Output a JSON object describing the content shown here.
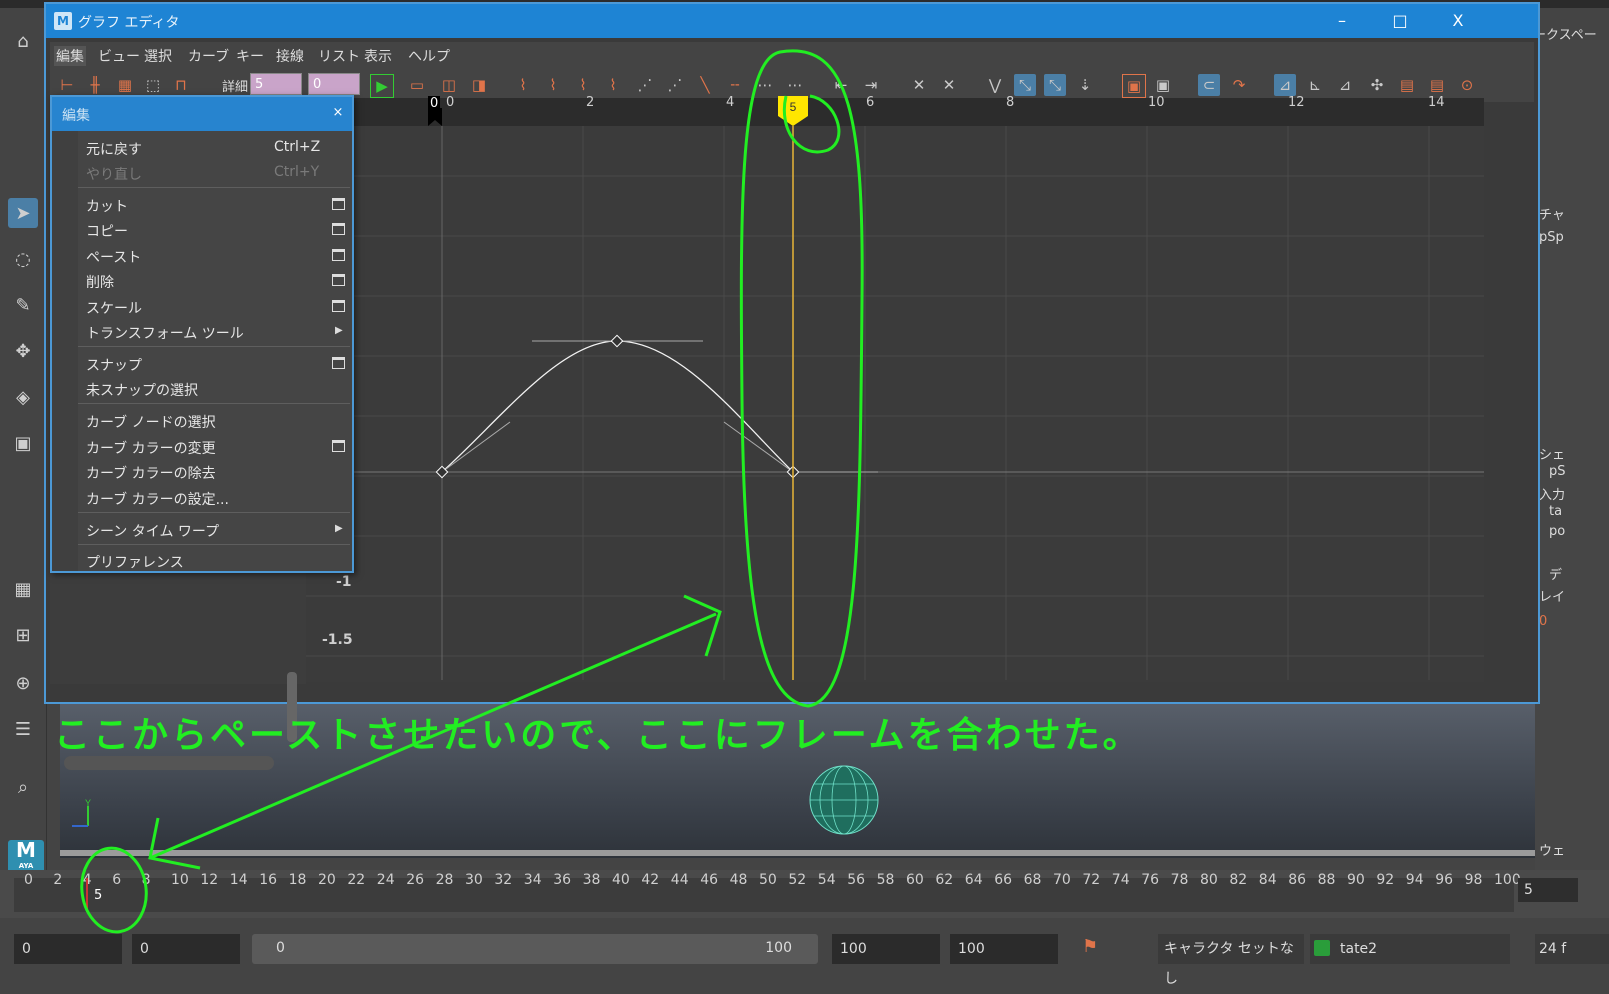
{
  "window": {
    "title": "グラフ エディタ",
    "icon": "M",
    "minimize": "–",
    "maximize": "□",
    "close": "X"
  },
  "workspace_label": "ワークスペース",
  "menubar": [
    "編集",
    "ビュー",
    "選択",
    "カーブ",
    "キー",
    "接線",
    "リスト",
    "表示",
    "ヘルプ"
  ],
  "toolbar": {
    "detail_label": "詳細",
    "detail_value": "5",
    "detail_value2": "0"
  },
  "ruler": {
    "ticks": [
      "0",
      "2",
      "4",
      "6",
      "8",
      "10",
      "12",
      "14"
    ],
    "start_marker": "0",
    "current_frame_marker": "5"
  },
  "yaxis": [
    "-1",
    "-1.5"
  ],
  "curve": {
    "color": "#ffffff",
    "keys": [
      {
        "frame": 0,
        "value": 0
      },
      {
        "frame": 2.5,
        "value": 1
      },
      {
        "frame": 5,
        "value": 0
      }
    ]
  },
  "edit_menu": {
    "title": "編集",
    "close": "×",
    "items": [
      {
        "label": "元に戻す",
        "shortcut": "Ctrl+Z",
        "disabled": false
      },
      {
        "label": "やり直し",
        "shortcut": "Ctrl+Y",
        "disabled": true
      },
      {
        "label": "カット"
      },
      {
        "label": "コピー"
      },
      {
        "label": "ペースト"
      },
      {
        "label": "削除"
      },
      {
        "label": "スケール"
      },
      {
        "label": "トランスフォーム ツール"
      },
      {
        "label": "スナップ"
      },
      {
        "label": "未スナップの選択"
      },
      {
        "label": "カーブ ノードの選択"
      },
      {
        "label": "カーブ カラーの変更"
      },
      {
        "label": "カーブ カラーの除去"
      },
      {
        "label": "カーブ カラーの設定..."
      },
      {
        "label": "シーン タイム ワープ"
      },
      {
        "label": "プリファレンス"
      }
    ]
  },
  "annotation": {
    "text": "ここからペーストさせたいので、ここにフレームを合わせた。",
    "color": "#22ee22"
  },
  "right_panel": {
    "labels": [
      "チャ",
      "pSp",
      "シェ",
      "pS",
      "入力",
      "ta",
      "po",
      "デ",
      "レイ",
      "0",
      "ウェ"
    ]
  },
  "timeline": {
    "ticks": [
      "0",
      "2",
      "4",
      "6",
      "8",
      "10",
      "12",
      "14",
      "16",
      "18",
      "20",
      "22",
      "24",
      "26",
      "28",
      "30",
      "32",
      "34",
      "36",
      "38",
      "40",
      "42",
      "44",
      "46",
      "48",
      "50",
      "52",
      "54",
      "56",
      "58",
      "60",
      "62",
      "64",
      "66",
      "68",
      "70",
      "72",
      "74",
      "76",
      "78",
      "80",
      "82",
      "84",
      "86",
      "88",
      "90",
      "92",
      "94",
      "96",
      "98",
      "100"
    ],
    "current_frame": "5",
    "frame_field": "5"
  },
  "range_bar": {
    "start_anim": "0",
    "start_range": "0",
    "slider_start": "0",
    "slider_end": "100",
    "end_range": "100",
    "end_anim": "100",
    "character_set": "キャラクタ セットなし",
    "anim_layer": "tate2",
    "fps": "24 f"
  },
  "colors": {
    "accent_blue": "#1e84d4",
    "time_marker": "#ffe600",
    "annotation": "#22ee22"
  }
}
